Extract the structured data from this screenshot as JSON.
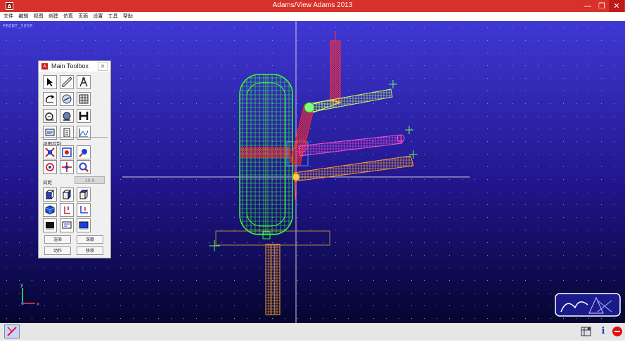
{
  "window": {
    "title": "Adams/View Adams 2013",
    "icon": "adams-logo-icon"
  },
  "title_controls": {
    "minimize": "—",
    "restore": "❐",
    "close": "✕"
  },
  "menu": [
    "文件",
    "编辑",
    "视图",
    "创建",
    "仿真",
    "页面",
    "设置",
    "工具",
    "帮助"
  ],
  "viewport": {
    "view_name": "FRONT_SUSP"
  },
  "triad": {
    "y": "y",
    "x": "x"
  },
  "toolbox": {
    "title": "Main Toolbox",
    "close": "✕",
    "section_label": "视图控制",
    "spacing_label": "间距",
    "spacing_value": "10.0",
    "btn_render": "渲染",
    "btn_depth": "深度",
    "btn_action": "动作",
    "btn_pan": "移移"
  },
  "status": {
    "info": "i"
  },
  "colors": {
    "viewport_top": "#4038d4",
    "viewport_bottom": "#050530",
    "titlebar": "#d6312a",
    "wheel": "#33ff33",
    "arms_orange": "#ffa020",
    "arms_magenta": "#ff40c0",
    "arms_green": "#c8ff60",
    "strut_red": "#e01818"
  }
}
